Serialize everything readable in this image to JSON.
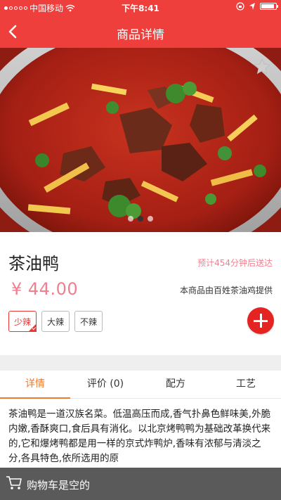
{
  "status_bar": {
    "carrier": "中国移动",
    "time": "下午8:41",
    "battery_level": 0.9
  },
  "navbar": {
    "title": "商品详情",
    "back_icon": "chevron-left-icon"
  },
  "gallery": {
    "favorite_icon": "star-icon",
    "slide_count": 3,
    "active_slide": 2
  },
  "product": {
    "name": "茶油鸭",
    "eta": "预计454分钟后送达",
    "price": "¥ 44.00",
    "provider": "本商品由百姓茶油鸡提供",
    "specs": [
      {
        "label": "少辣",
        "selected": true
      },
      {
        "label": "大辣",
        "selected": false
      },
      {
        "label": "不辣",
        "selected": false
      }
    ],
    "add_icon": "plus-circle-icon"
  },
  "tabs": [
    {
      "label": "详情",
      "active": true
    },
    {
      "label": "评价 (0)",
      "active": false
    },
    {
      "label": "配方",
      "active": false
    },
    {
      "label": "工艺",
      "active": false
    }
  ],
  "description": "茶油鸭是一道汉族名菜。低温高压而成,香气扑鼻色鲜味美,外脆内嫩,香酥爽口,食后具有消化。以北京烤鸭鸭为基础改革换代来的,它和爆烤鸭都是用一样的京式炸鸭炉,香味有浓郁与清淡之分,各具特色,依所选用的原",
  "cart": {
    "icon": "cart-icon",
    "empty_text": "购物车是空的"
  },
  "colors": {
    "brand_red": "#ef3f3c",
    "price_pink": "#f07f8f",
    "tab_active": "#ef7a2b",
    "add_button": "#e52421",
    "cart_bar": "#5a5a5a"
  }
}
